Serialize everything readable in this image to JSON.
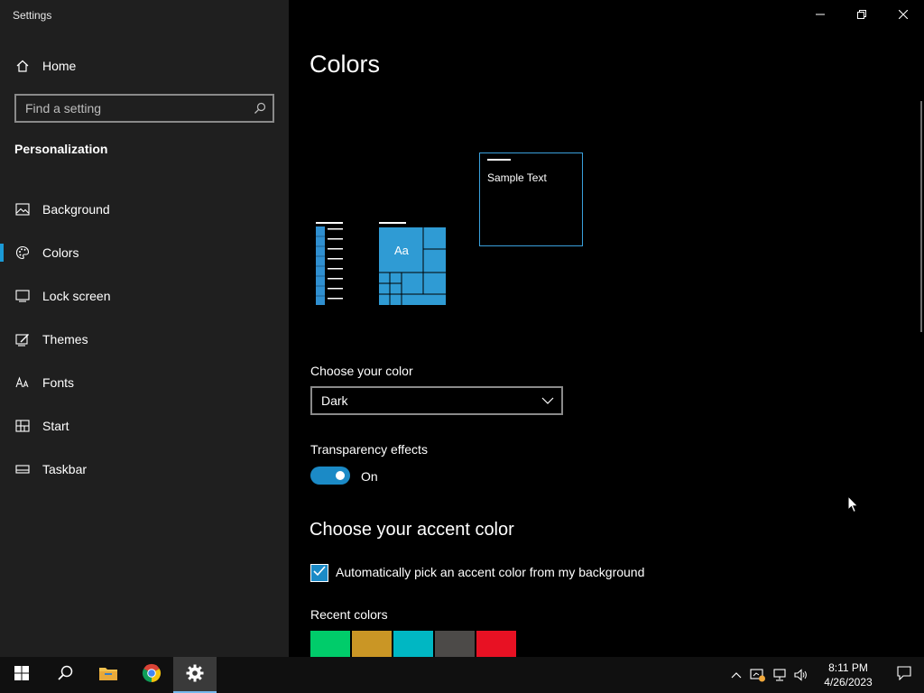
{
  "window": {
    "title": "Settings"
  },
  "sidebar": {
    "home_label": "Home",
    "search_placeholder": "Find a setting",
    "section_title": "Personalization",
    "items": [
      {
        "label": "Background",
        "icon": "image-icon"
      },
      {
        "label": "Colors",
        "icon": "palette-icon",
        "active": true
      },
      {
        "label": "Lock screen",
        "icon": "lock-screen-icon"
      },
      {
        "label": "Themes",
        "icon": "themes-icon"
      },
      {
        "label": "Fonts",
        "icon": "fonts-icon"
      },
      {
        "label": "Start",
        "icon": "start-icon"
      },
      {
        "label": "Taskbar",
        "icon": "taskbar-icon"
      }
    ]
  },
  "main": {
    "title": "Colors",
    "preview": {
      "sample_text": "Sample Text",
      "tile_text": "Aa"
    },
    "choose_color": {
      "label": "Choose your color",
      "value": "Dark"
    },
    "transparency": {
      "label": "Transparency effects",
      "state": "On"
    },
    "accent": {
      "title": "Choose your accent color",
      "auto_label": "Automatically pick an accent color from my background",
      "recent_label": "Recent colors",
      "recent_colors": [
        "#00cc6a",
        "#ca9625",
        "#00b7c3",
        "#4c4a48",
        "#e81123"
      ]
    }
  },
  "taskbar": {
    "time": "8:11 PM",
    "date": "4/26/2023"
  },
  "colors": {
    "accent": "#1b8ac6",
    "sidebar_bg": "#1f1f1f",
    "main_bg": "#000000"
  }
}
